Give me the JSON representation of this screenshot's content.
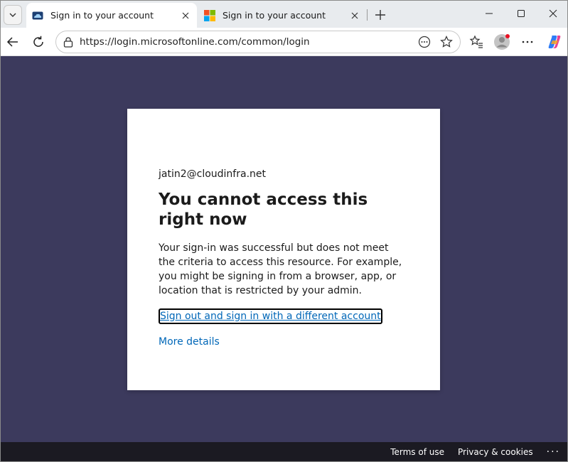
{
  "browser": {
    "tabs": [
      {
        "title": "Sign in to your account",
        "active": true,
        "favicon": "cloud-icon"
      },
      {
        "title": "Sign in to your account",
        "active": false,
        "favicon": "microsoft-logo-icon"
      }
    ],
    "url": "https://login.microsoftonline.com/common/login"
  },
  "card": {
    "identity": "jatin2@cloudinfra.net",
    "heading": "You cannot access this right now",
    "description": "Your sign-in was successful but does not meet the criteria to access this resource. For example, you might be signing in from a browser, app, or location that is restricted by your admin.",
    "signout_link": "Sign out and sign in with a different account",
    "more_details_link": "More details"
  },
  "footer": {
    "terms": "Terms of use",
    "privacy": "Privacy & cookies",
    "more": "···"
  },
  "colors": {
    "page_background": "#3c3a5d",
    "link": "#0067b8",
    "footer_background": "#1b1a22"
  }
}
